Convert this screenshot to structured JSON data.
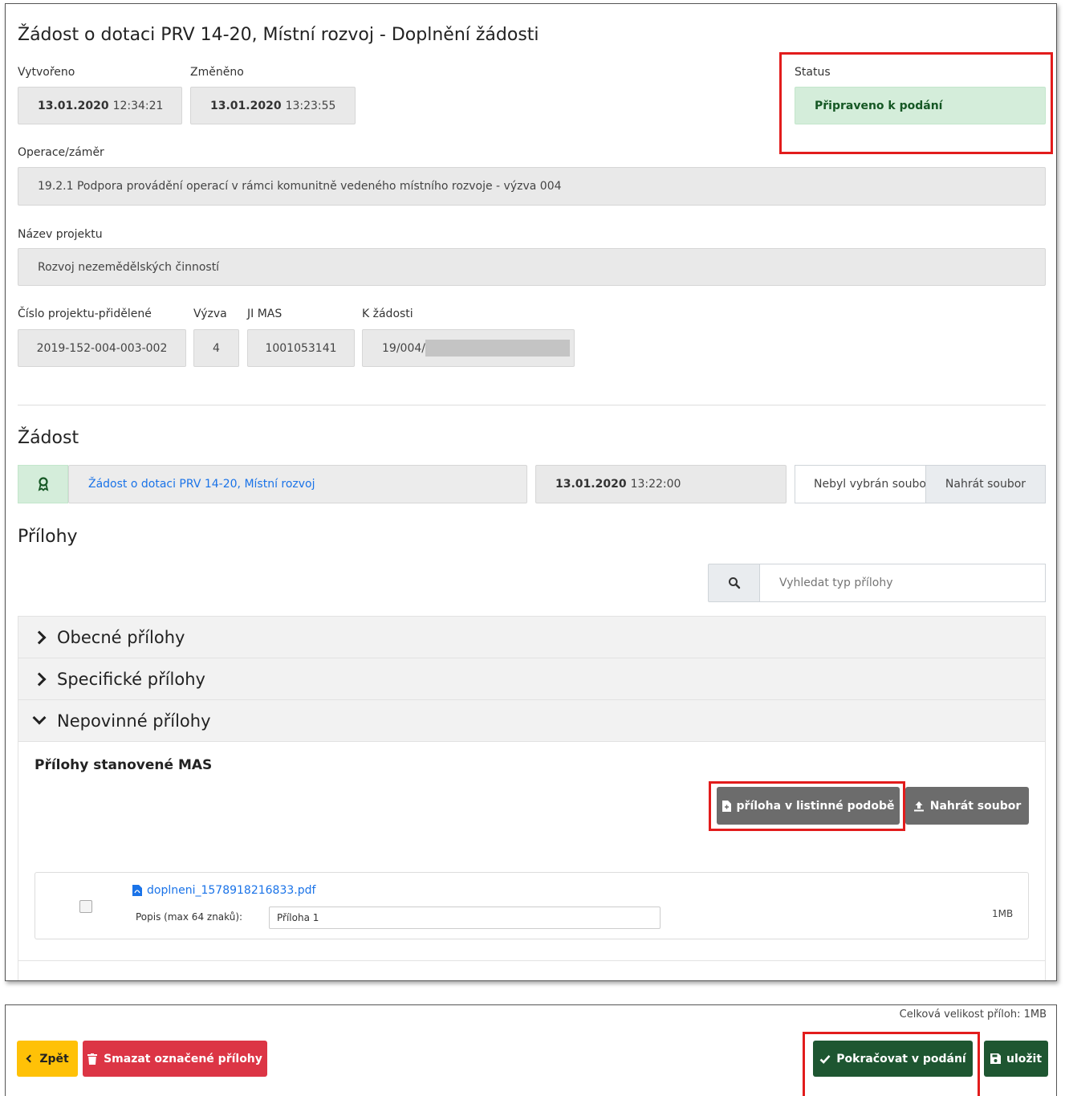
{
  "header": {
    "title": "Žádost o dotaci PRV 14-20, Místní rozvoj - Doplnění žádosti",
    "created_label": "Vytvořeno",
    "created_date": "13.01.2020",
    "created_time": "12:34:21",
    "changed_label": "Změněno",
    "changed_date": "13.01.2020",
    "changed_time": "13:23:55",
    "status_label": "Status",
    "status_value": "Připraveno k podání"
  },
  "operation": {
    "label": "Operace/záměr",
    "value": "19.2.1 Podpora provádění operací v rámci komunitně vedeného místního rozvoje - výzva 004"
  },
  "project": {
    "name_label": "Název projektu",
    "name_value": "Rozvoj nezemědělských činností",
    "number_label": "Číslo projektu-přidělené",
    "number_value": "2019-152-004-003-002",
    "call_label": "Výzva",
    "call_value": "4",
    "mas_label": "JI MAS",
    "mas_value": "1001053141",
    "request_label": "K žádosti",
    "request_value": "19/004/"
  },
  "application": {
    "heading": "Žádost",
    "link": "Žádost o dotaci PRV 14-20, Místní rozvoj",
    "date": "13.01.2020",
    "time": "13:22:00",
    "file_placeholder": "Nebyl vybrán soubo",
    "upload_label": "Nahrát soubor"
  },
  "attachments": {
    "heading": "Přílohy",
    "search_placeholder": "Vyhledat typ přílohy",
    "sections": [
      "Obecné přílohy",
      "Specifické přílohy",
      "Nepovinné přílohy"
    ],
    "subheading": "Přílohy stanovené MAS",
    "paper_button": "příloha v listinné podobě",
    "upload_button": "Nahrát soubor",
    "file": {
      "name": "doplneni_1578918216833.pdf",
      "desc_label": "Popis (max 64 znaků):",
      "desc_value": "Příloha 1",
      "size": "1MB"
    }
  },
  "footer": {
    "total_size": "Celková velikost příloh: 1MB",
    "back_label": "Zpět",
    "delete_label": "Smazat označené přílohy",
    "continue_label": "Pokračovat v podání",
    "save_label": "uložit"
  },
  "colors": {
    "status_bg": "#d4edda",
    "status_text": "#155724",
    "highlight_border": "#e21c1c",
    "back_btn": "#ffc107",
    "delete_btn": "#dc3545",
    "continue_btn": "#1e5631",
    "link": "#1a73e8"
  }
}
